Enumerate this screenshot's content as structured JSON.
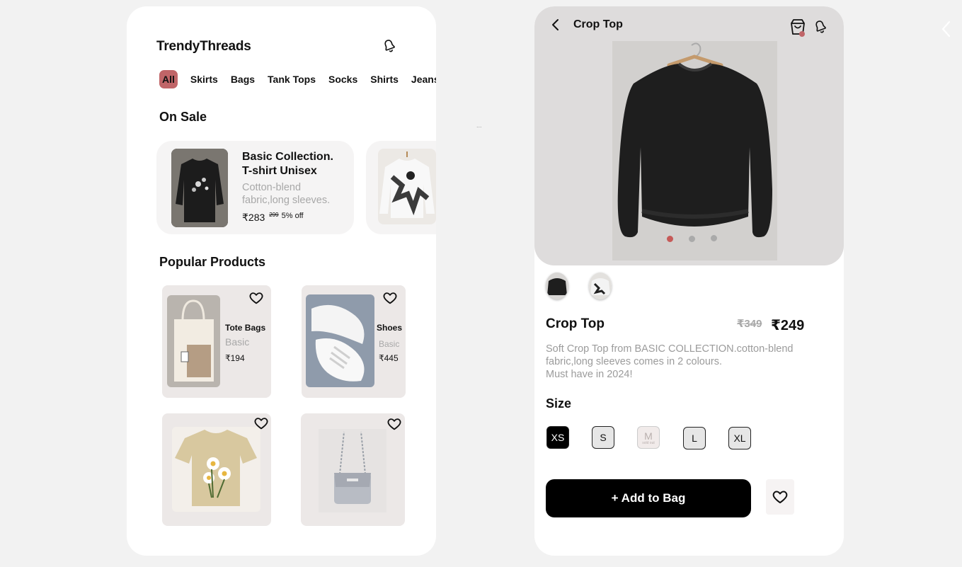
{
  "home": {
    "brand": "TrendyThreads",
    "categories": [
      "All",
      "Skirts",
      "Bags",
      "Tank Tops",
      "Socks",
      "Shirts",
      "Jeans"
    ],
    "on_sale_title": "On Sale",
    "sale_card": {
      "title_line1": "Basic Collection.",
      "title_line2": "T-shirt Unisex",
      "desc_line1": "Cotton-blend",
      "desc_line2": "fabric,long sleeves.",
      "price": "₹283",
      "old_price": "299",
      "discount": "5% off"
    },
    "popular_title": "Popular Products",
    "products": [
      {
        "name": "Tote Bags",
        "sub": "Basic",
        "price": "₹194"
      },
      {
        "name": "Shoes",
        "sub": "Basic",
        "price": "₹445"
      }
    ],
    "dots_text": "..."
  },
  "detail": {
    "header_title": "Crop Top",
    "cart_badge": "",
    "name": "Crop Top",
    "old_price": "₹349",
    "price": "₹249",
    "desc_line1": "Soft Crop Top from BASIC COLLECTION.cotton-blend",
    "desc_line2": "fabric,long sleeves comes in 2 colours.",
    "desc_line3": "Must have in 2024!",
    "size_title": "Size",
    "sizes": [
      "XS",
      "S",
      "M",
      "L",
      "XL"
    ],
    "sold_out_label": "sold out",
    "add_to_bag": "+ Add to Bag"
  },
  "colors": {
    "accent": "#c06568",
    "active_dot": "#c65a58",
    "muted_text": "#a8a8a8"
  }
}
